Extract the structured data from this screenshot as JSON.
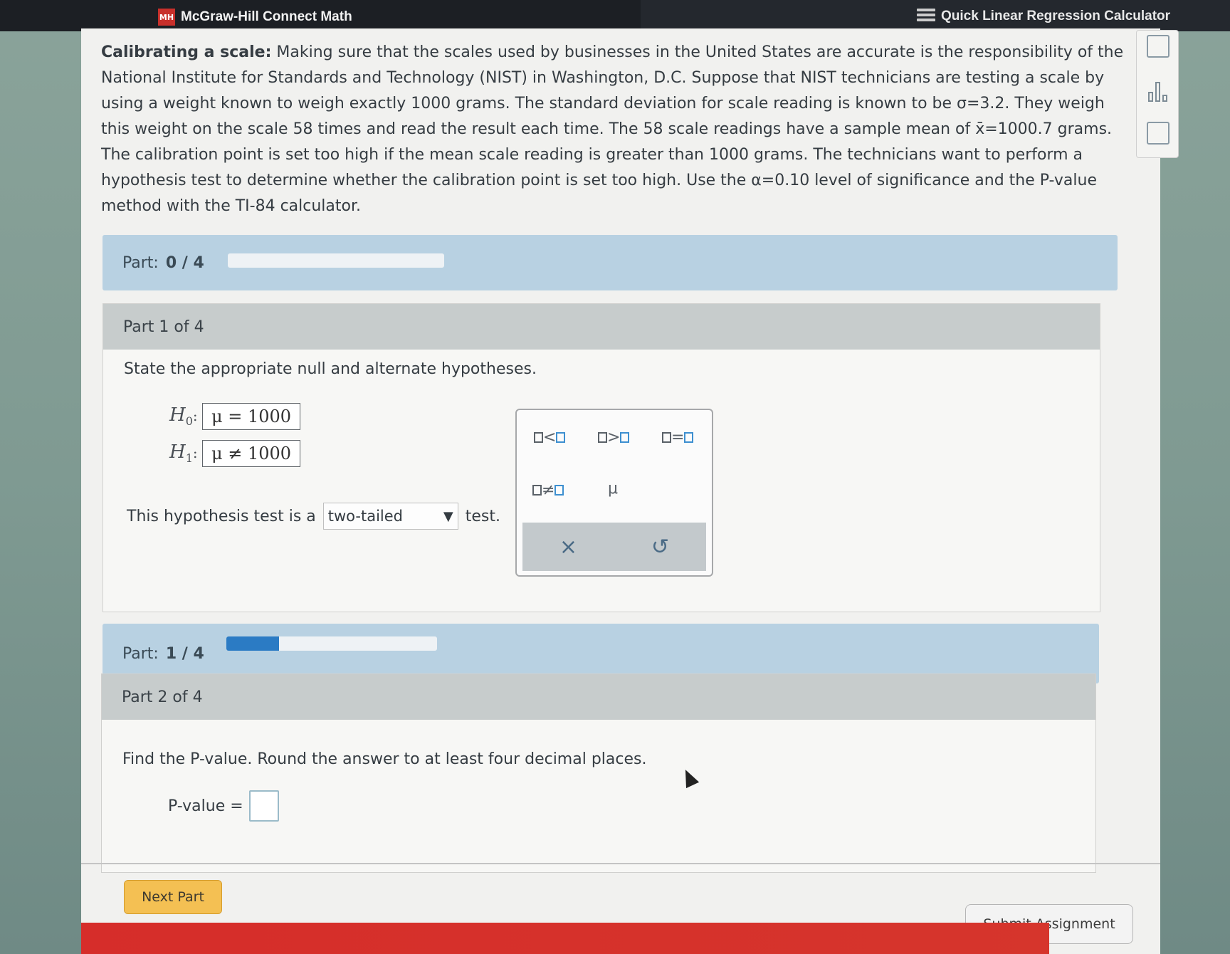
{
  "topbar": {
    "app_title": "McGraw-Hill Connect Math",
    "calculator_link": "Quick Linear Regression Calculator"
  },
  "problem": {
    "title": "Calibrating a scale:",
    "text_1": " Making sure that the scales used by businesses in the United States are accurate is the responsibility of the National Institute for Standards and Technology (NIST) in Washington, D.C. Suppose that NIST technicians are testing a scale by using a weight known to weigh exactly 1000 grams. The standard deviation for scale reading is known to be σ=3.2. They weigh this weight on the scale 58 times and read the result each time. The 58 scale readings have a sample mean of x̄=1000.7 grams. The calibration point is set too high if the mean scale reading is greater than 1000 grams. The technicians want to perform a hypothesis test to determine whether the calibration point is set too high. Use the α=0.10 level of significance and the P-value method with the TI-84 calculator."
  },
  "part_progress_1": {
    "label": "Part:",
    "count": "0 / 4",
    "fraction": 0.0
  },
  "part1": {
    "header": "Part 1 of 4",
    "instruction": "State the appropriate null and alternate hypotheses.",
    "h0_label": "H",
    "h0_sub": "0",
    "h0_value": "μ = 1000",
    "h1_label": "H",
    "h1_sub": "1",
    "h1_value": "μ ≠ 1000",
    "colon": ":",
    "test_prefix": "This hypothesis test is a",
    "test_selected": "two-tailed",
    "test_suffix": "test."
  },
  "keypad": {
    "less": "<",
    "greater": ">",
    "equal": "=",
    "not_equal": "≠",
    "mu": "μ",
    "clear": "×",
    "undo": "↺"
  },
  "part_progress_2": {
    "label": "Part:",
    "count": "1 / 4",
    "fraction": 0.25
  },
  "part2": {
    "header": "Part 2 of 4",
    "instruction": "Find the P-value. Round the answer to at least four decimal places.",
    "pvalue_label": "P-value =",
    "pvalue_value": ""
  },
  "buttons": {
    "next_part": "Next Part",
    "submit": "Submit Assignment"
  },
  "colors": {
    "accent_blue": "#2b7bc4",
    "next_button": "#f4c053",
    "brand_red": "#c8302b"
  }
}
